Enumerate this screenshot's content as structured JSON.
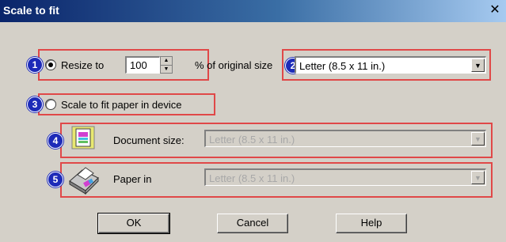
{
  "window": {
    "title": "Scale to fit",
    "close_glyph": "✕"
  },
  "callouts": [
    "1",
    "2",
    "3",
    "4",
    "5"
  ],
  "resize": {
    "label": "Resize to",
    "value": "100",
    "suffix": "% of original size",
    "selected": true,
    "paper": "Letter (8.5 x 11 in.)"
  },
  "scale_to_fit": {
    "label": "Scale to fit paper in device",
    "selected": false
  },
  "document_size": {
    "label": "Document size:",
    "value": "Letter (8.5 x 11 in.)"
  },
  "paper_in": {
    "label": "Paper in",
    "value": "Letter (8.5 x 11 in.)"
  },
  "buttons": {
    "ok": "OK",
    "cancel": "Cancel",
    "help": "Help"
  },
  "icons": [
    "document-icon",
    "printer-icon",
    "spin-up-icon",
    "spin-down-icon",
    "dropdown-arrow-icon"
  ],
  "colors": {
    "callout_border": "#e04848",
    "badge": "#1d2bb8",
    "titlebar": "#0a246a",
    "dialog": "#d4d0c8"
  }
}
